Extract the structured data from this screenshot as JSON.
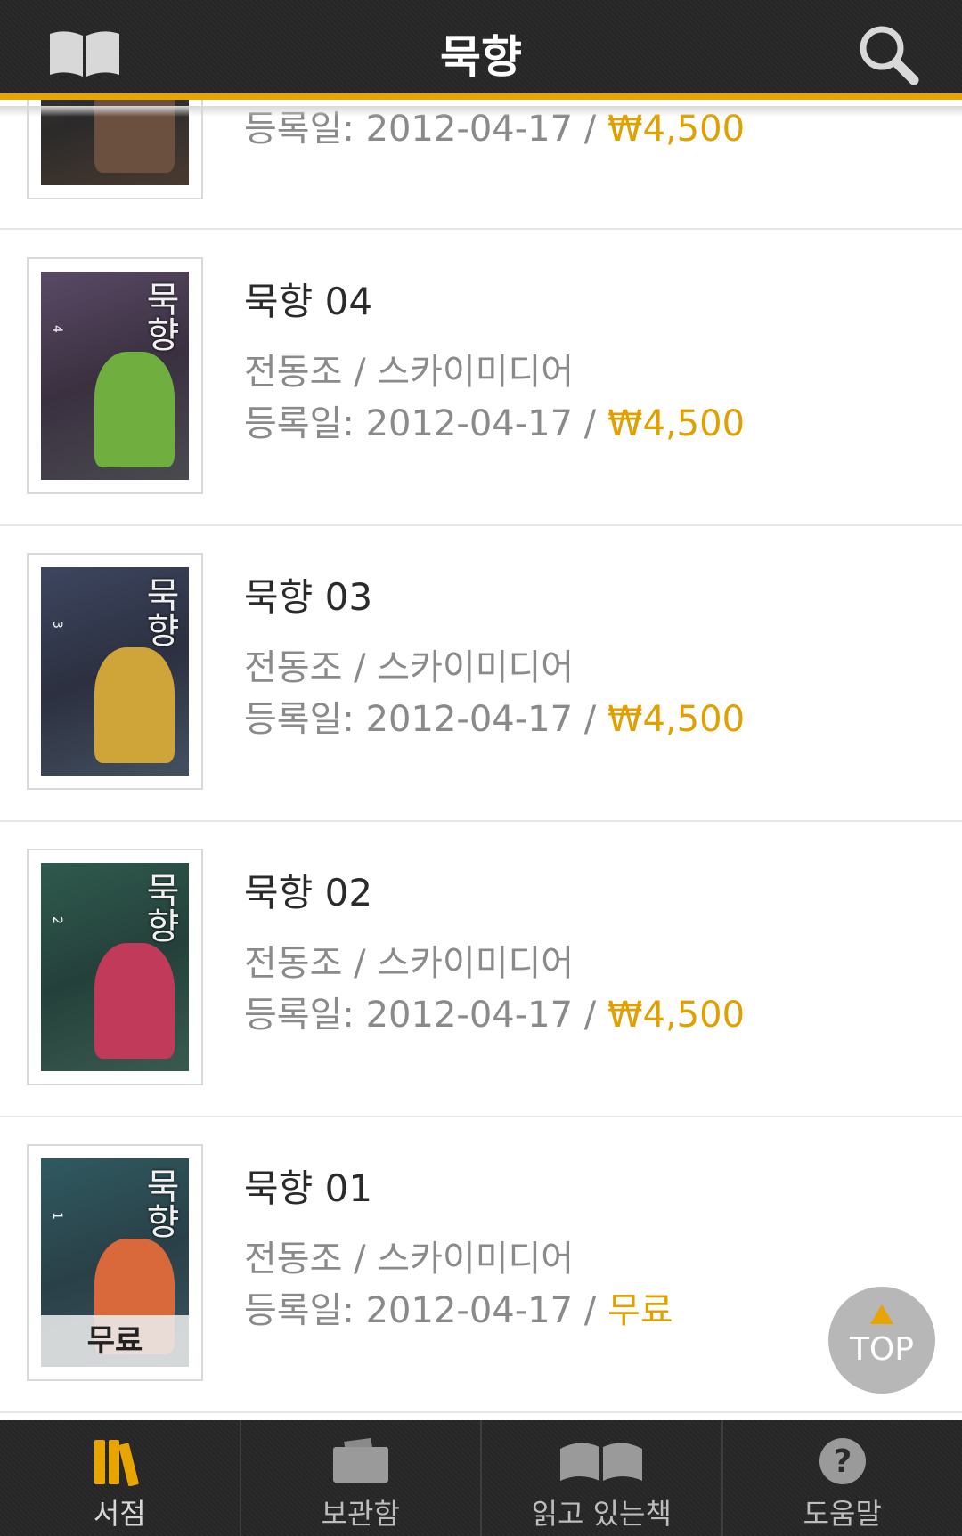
{
  "header": {
    "title": "묵향"
  },
  "rows": [
    {
      "title": "",
      "author": "",
      "date": "등록일: 2012-04-17 / ",
      "price": "₩4,500",
      "cover_color": "#6b5040",
      "vol": ""
    },
    {
      "title": "묵향 04",
      "author": "전동조 / 스카이미디어",
      "date": "등록일: 2012-04-17 / ",
      "price": "₩4,500",
      "cover_color": "#6fae3f",
      "vol": "4"
    },
    {
      "title": "묵향 03",
      "author": "전동조 / 스카이미디어",
      "date": "등록일: 2012-04-17 / ",
      "price": "₩4,500",
      "cover_color": "#cfa53a",
      "vol": "3"
    },
    {
      "title": "묵향 02",
      "author": "전동조 / 스카이미디어",
      "date": "등록일: 2012-04-17 / ",
      "price": "₩4,500",
      "cover_color": "#c23a5a",
      "vol": "2"
    },
    {
      "title": "묵향 01",
      "author": "전동조 / 스카이미디어",
      "date": "등록일: 2012-04-17 / ",
      "price": "무료",
      "cover_color": "#d9683a",
      "vol": "1",
      "cover_badge": "무료"
    }
  ],
  "cover_text": "묵향",
  "top_button": {
    "label": "TOP"
  },
  "tabbar": [
    {
      "label": "서점",
      "icon": "bookstore-icon"
    },
    {
      "label": "보관함",
      "icon": "folder-icon"
    },
    {
      "label": "읽고 있는책",
      "icon": "open-book-icon"
    },
    {
      "label": "도움말",
      "icon": "help-icon"
    }
  ],
  "colors": {
    "accent": "#e8a400",
    "price": "#e0a000",
    "header_bg": "#2b2b2b"
  }
}
